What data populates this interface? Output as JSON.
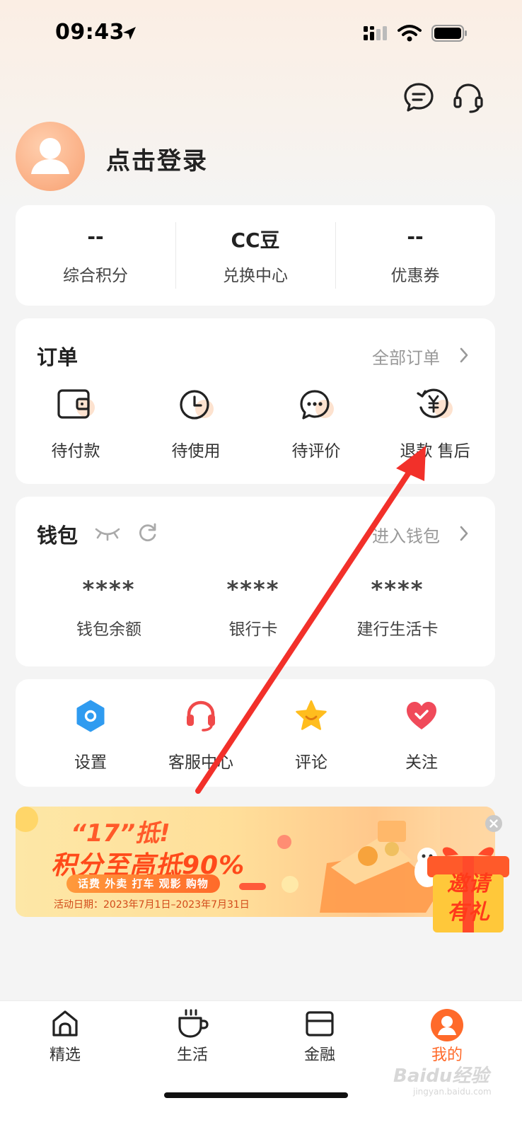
{
  "status_bar": {
    "time": "09:43"
  },
  "profile": {
    "login_text": "点击登录"
  },
  "stats": [
    {
      "value": "--",
      "label": "综合积分"
    },
    {
      "value": "CC豆",
      "label": "兑换中心"
    },
    {
      "value": "--",
      "label": "优惠券"
    }
  ],
  "orders": {
    "title": "订单",
    "all_link": "全部订单",
    "items": [
      {
        "label": "待付款",
        "icon": "wallet-icon"
      },
      {
        "label": "待使用",
        "icon": "clock-icon"
      },
      {
        "label": "待评价",
        "icon": "comment-icon"
      },
      {
        "label": "退款  售后",
        "icon": "refund-yen-icon"
      }
    ]
  },
  "wallet": {
    "title": "钱包",
    "enter_link": "进入钱包",
    "items": [
      {
        "value": "****",
        "label": "钱包余额"
      },
      {
        "value": "****",
        "label": "银行卡"
      },
      {
        "value": "****",
        "label": "建行生活卡"
      }
    ]
  },
  "services": [
    {
      "label": "设置",
      "icon": "settings-hexagon-icon",
      "color": "#2f9bf0"
    },
    {
      "label": "客服中心",
      "icon": "headset-icon",
      "color": "#f04a4a"
    },
    {
      "label": "评论",
      "icon": "star-icon",
      "color": "#ffb81e"
    },
    {
      "label": "关注",
      "icon": "heart-icon",
      "color": "#f04a5a"
    }
  ],
  "banner": {
    "title_line1": "“17”抵!",
    "title_line2": "积分至高抵90%",
    "tags": "话费 外卖 打车 观影 购物",
    "date": "活动日期：2023年7月1日–2023年7月31日"
  },
  "invite": {
    "line1": "邀请",
    "line2": "有礼"
  },
  "tabbar": [
    {
      "label": "精选",
      "icon": "home-icon",
      "active": false
    },
    {
      "label": "生活",
      "icon": "cup-icon",
      "active": false
    },
    {
      "label": "金融",
      "icon": "card-icon",
      "active": false
    },
    {
      "label": "我的",
      "icon": "user-icon",
      "active": true
    }
  ],
  "watermark": {
    "main": "Baidu经验",
    "sub": "jingyan.baidu.com"
  },
  "colors": {
    "accent": "#ff6a2a",
    "annotation_arrow": "#f2302a"
  }
}
